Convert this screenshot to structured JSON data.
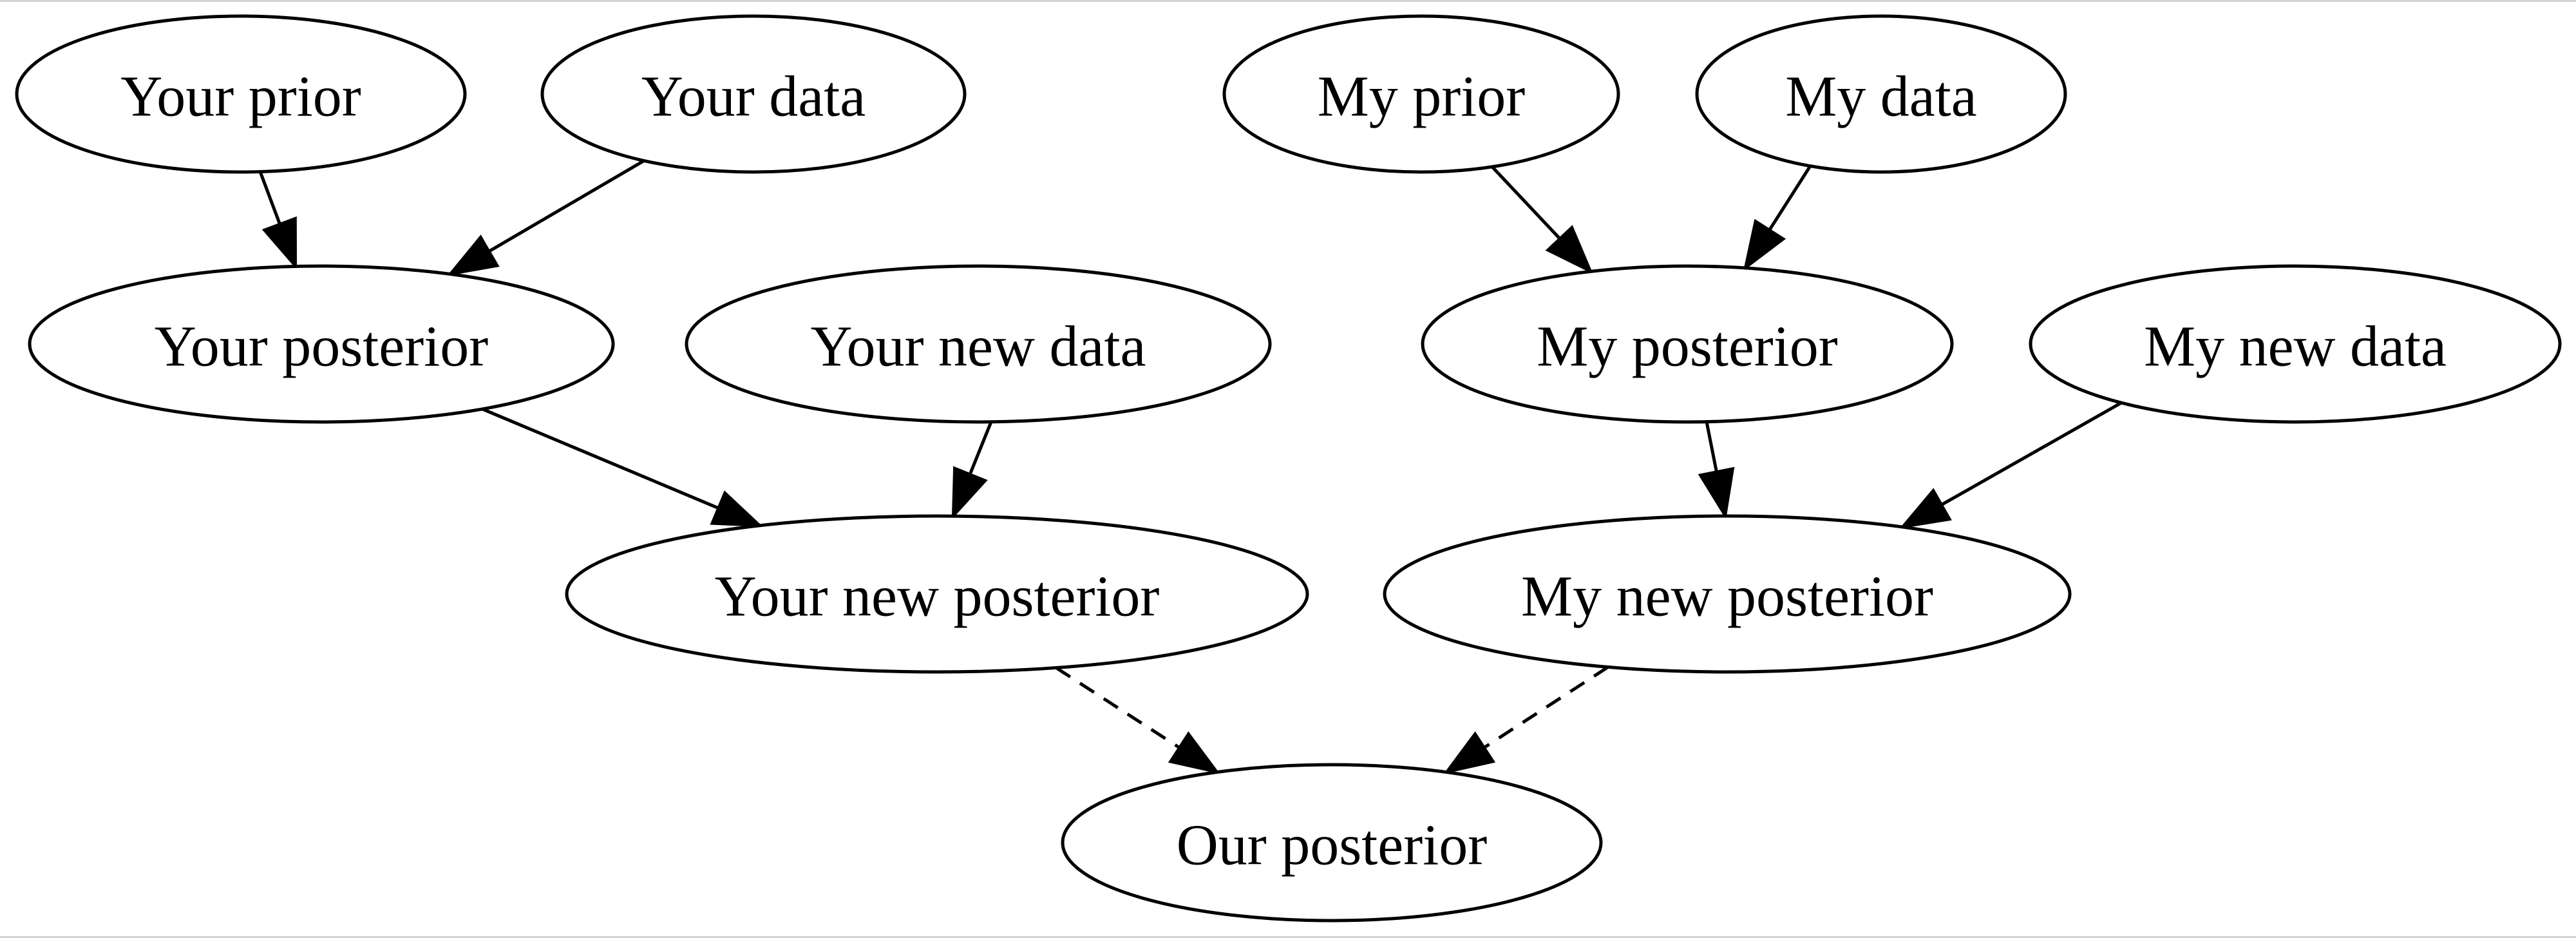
{
  "diagram": {
    "type": "directed-graph",
    "nodes": [
      {
        "id": "your_prior",
        "label": "Your prior",
        "shape": "ellipse"
      },
      {
        "id": "your_data",
        "label": "Your data",
        "shape": "ellipse"
      },
      {
        "id": "my_prior",
        "label": "My prior",
        "shape": "ellipse"
      },
      {
        "id": "my_data",
        "label": "My data",
        "shape": "ellipse"
      },
      {
        "id": "your_posterior",
        "label": "Your posterior",
        "shape": "ellipse"
      },
      {
        "id": "your_new_data",
        "label": "Your new data",
        "shape": "ellipse"
      },
      {
        "id": "my_posterior",
        "label": "My posterior",
        "shape": "ellipse"
      },
      {
        "id": "my_new_data",
        "label": "My new data",
        "shape": "ellipse"
      },
      {
        "id": "your_new_posterior",
        "label": "Your new posterior",
        "shape": "ellipse"
      },
      {
        "id": "my_new_posterior",
        "label": "My new posterior",
        "shape": "ellipse"
      },
      {
        "id": "our_posterior",
        "label": "Our posterior",
        "shape": "ellipse"
      }
    ],
    "edges": [
      {
        "from": "your_prior",
        "to": "your_posterior",
        "style": "solid"
      },
      {
        "from": "your_data",
        "to": "your_posterior",
        "style": "solid"
      },
      {
        "from": "my_prior",
        "to": "my_posterior",
        "style": "solid"
      },
      {
        "from": "my_data",
        "to": "my_posterior",
        "style": "solid"
      },
      {
        "from": "your_posterior",
        "to": "your_new_posterior",
        "style": "solid"
      },
      {
        "from": "your_new_data",
        "to": "your_new_posterior",
        "style": "solid"
      },
      {
        "from": "my_posterior",
        "to": "my_new_posterior",
        "style": "solid"
      },
      {
        "from": "my_new_data",
        "to": "my_new_posterior",
        "style": "solid"
      },
      {
        "from": "your_new_posterior",
        "to": "our_posterior",
        "style": "dashed"
      },
      {
        "from": "my_new_posterior",
        "to": "our_posterior",
        "style": "dashed"
      }
    ]
  }
}
